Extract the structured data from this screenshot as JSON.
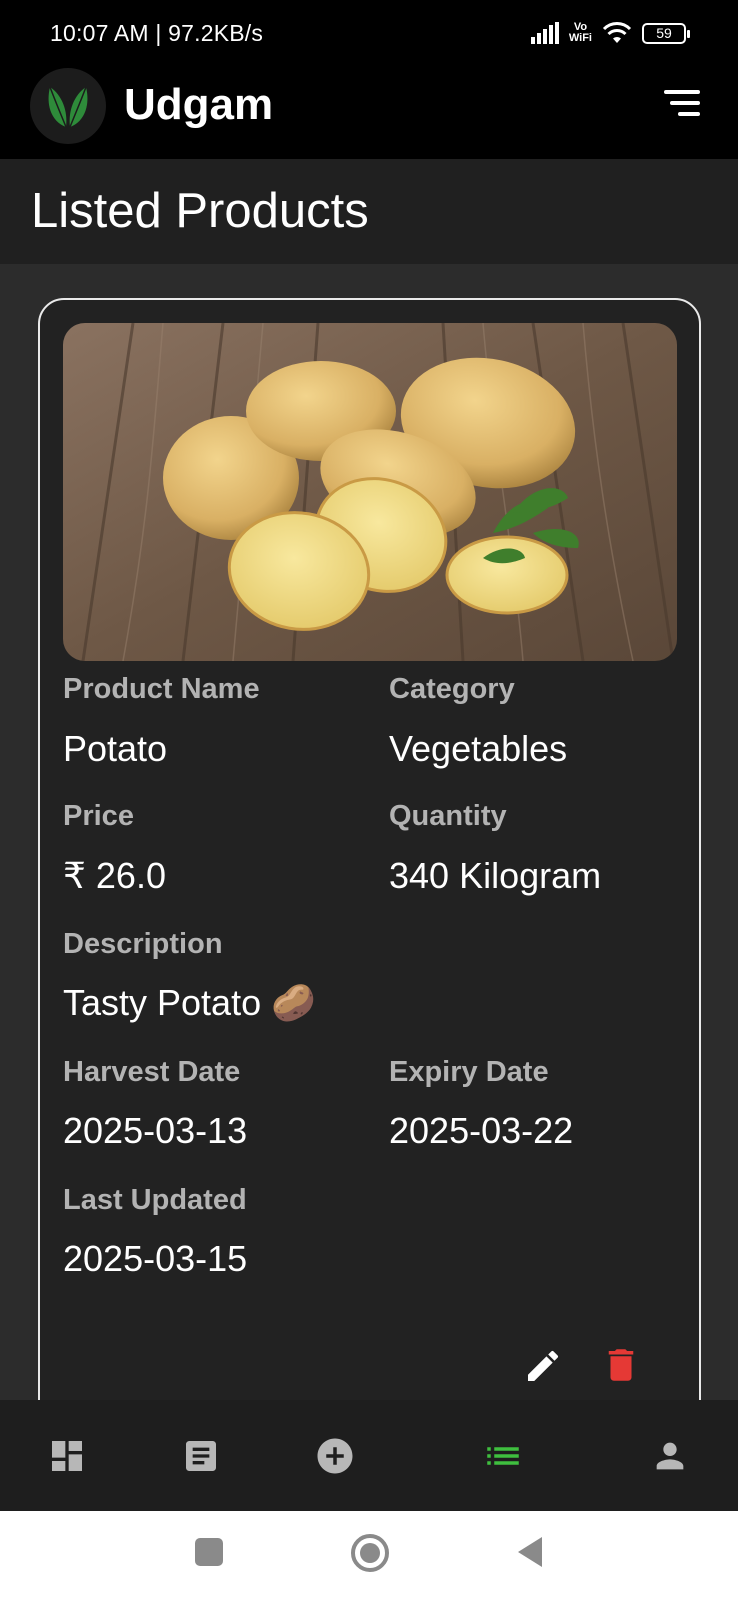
{
  "status_bar": {
    "time": "10:07 AM | 97.2KB/s",
    "network_label": "Vo\nWiFi",
    "battery": "59"
  },
  "header": {
    "app_title": "Udgam",
    "logo_icon": "leaf-logo-icon",
    "menu_icon": "sort-menu-icon"
  },
  "page": {
    "title": "Listed Products"
  },
  "product": {
    "labels": {
      "name": "Product Name",
      "category": "Category",
      "price": "Price",
      "quantity": "Quantity",
      "description": "Description",
      "harvest_date": "Harvest Date",
      "expiry_date": "Expiry Date",
      "last_updated": "Last Updated"
    },
    "values": {
      "name": "Potato",
      "category": "Vegetables",
      "price": "₹ 26.0",
      "quantity": "340 Kilogram",
      "description": "Tasty Potato 🥔",
      "harvest_date": "2025-03-13",
      "expiry_date": "2025-03-22",
      "last_updated": "2025-03-15"
    },
    "actions": [
      "edit-icon",
      "delete-icon"
    ]
  },
  "bottom_nav": {
    "items": [
      "dashboard-icon",
      "article-icon",
      "add-circle-icon",
      "list-icon",
      "person-icon"
    ],
    "active_index": 3,
    "active_color": "#3fbf3f"
  },
  "system_nav": [
    "recents-square-icon",
    "home-circle-icon",
    "back-triangle-icon"
  ],
  "colors": {
    "delete": "#e53935",
    "background": "#2c2c2c",
    "card": "#222222"
  }
}
